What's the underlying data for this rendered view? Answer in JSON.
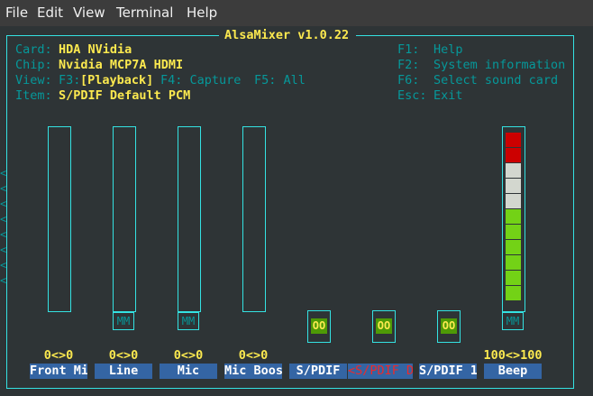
{
  "menu": [
    "File",
    "Edit",
    "View",
    "Terminal",
    "Help"
  ],
  "title": "AlsaMixer v1.0.22",
  "info": {
    "card_label": "Card:",
    "card": "HDA NVidia",
    "chip_label": "Chip:",
    "chip": "Nvidia MCP7A HDMI",
    "view_label": "View:",
    "view_f3": "F3:",
    "view_playback": "[Playback]",
    "view_f4": "F4: Capture",
    "view_f5": "F5: All",
    "item_label": "Item:",
    "item": "S/PDIF Default PCM"
  },
  "help": [
    {
      "key": "F1:",
      "text": "Help"
    },
    {
      "key": "F2:",
      "text": "System information"
    },
    {
      "key": "F6:",
      "text": "Select sound card"
    },
    {
      "key": "Esc:",
      "text": "Exit"
    }
  ],
  "controls": [
    {
      "name": "Front Mi",
      "value": "0<>0",
      "type": "volume",
      "mute": "",
      "level": 0
    },
    {
      "name": "Line",
      "value": "0<>0",
      "type": "volume",
      "mute": "MM",
      "level": 0
    },
    {
      "name": "Mic",
      "value": "0<>0",
      "type": "volume",
      "mute": "MM",
      "level": 0
    },
    {
      "name": "Mic Boos",
      "value": "0<>0",
      "type": "volume",
      "mute": "",
      "level": 0
    },
    {
      "name": "S/PDIF",
      "value": "",
      "type": "switch",
      "mute": "OO"
    },
    {
      "name": "<S/PDIF D>",
      "value": "",
      "type": "switch",
      "mute": "OO",
      "selected": true
    },
    {
      "name": "S/PDIF 1",
      "value": "",
      "type": "switch",
      "mute": "OO"
    },
    {
      "name": "Beep",
      "value": "100<>100",
      "type": "volume",
      "mute": "MM",
      "level": 1.0
    }
  ],
  "left_arrows": "<\n<\n<\n<\n<\n<\n<\n<",
  "colors": {
    "bar_red": "#cc0000",
    "bar_white": "#d3d7cf",
    "bar_green": "#73d216",
    "frame": "#34e2e2",
    "accent": "#fce94f"
  }
}
